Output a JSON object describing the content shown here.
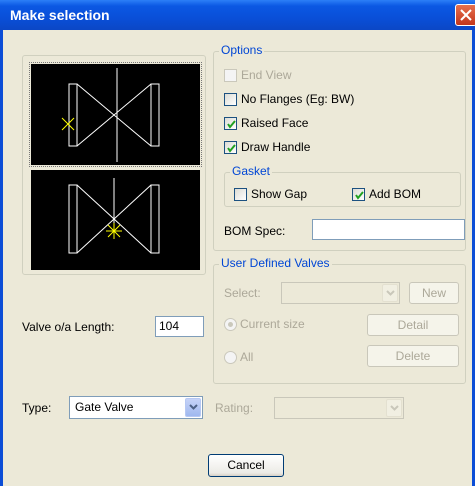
{
  "window": {
    "title": "Make selection"
  },
  "options": {
    "legend": "Options",
    "end_view": {
      "label": "End View",
      "checked": false,
      "enabled": false
    },
    "no_flanges": {
      "label": "No Flanges (Eg: BW)",
      "checked": false
    },
    "raised_face": {
      "label": "Raised Face",
      "checked": true
    },
    "draw_handle": {
      "label": "Draw Handle",
      "checked": true
    },
    "gasket": {
      "legend": "Gasket",
      "show_gap": {
        "label": "Show Gap",
        "checked": false
      },
      "add_bom": {
        "label": "Add BOM",
        "checked": true
      }
    },
    "bom_spec": {
      "label": "BOM Spec:",
      "value": ""
    }
  },
  "user_defined": {
    "legend": "User Defined Valves",
    "select_label": "Select:",
    "select_value": "",
    "new_label": "New",
    "current_size_label": "Current size",
    "current_size_selected": true,
    "detail_label": "Detail",
    "all_label": "All",
    "delete_label": "Delete"
  },
  "valve_length": {
    "label": "Valve o/a Length:",
    "value": "104"
  },
  "type": {
    "label": "Type:",
    "value": "Gate Valve"
  },
  "rating": {
    "label": "Rating:",
    "value": ""
  },
  "cancel_label": "Cancel",
  "colors": {
    "titlebar": "#0a4fd8",
    "face": "#ece9d8",
    "group_legend": "#0046d5",
    "preview_bg": "#000000",
    "preview_lines": "#ffffff",
    "marker": "#ffff00"
  }
}
